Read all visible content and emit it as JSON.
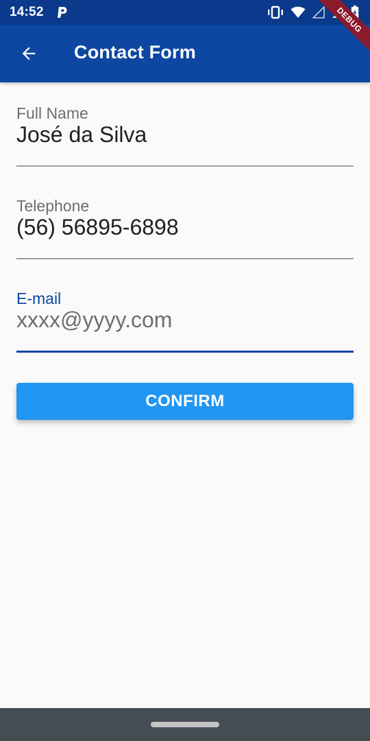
{
  "status_bar": {
    "time": "14:52",
    "icons": [
      "p-notification-icon",
      "vibrate-icon",
      "wifi-icon",
      "signal-icon",
      "battery-charging-icon"
    ]
  },
  "app_bar": {
    "title": "Contact Form",
    "back_icon": "arrow-back-icon",
    "color": "#0d47a1"
  },
  "debug_banner": "DEBUG",
  "form": {
    "full_name": {
      "label": "Full Name",
      "value": "José da Silva"
    },
    "telephone": {
      "label": "Telephone",
      "value": "(56) 56895-6898"
    },
    "email": {
      "label": "E-mail",
      "placeholder": "xxxx@yyyy.com",
      "focused": true
    },
    "confirm_label": "CONFIRM",
    "confirm_color": "#2196f3"
  },
  "nav_bar": {
    "home_handle": "home-gesture-pill"
  }
}
